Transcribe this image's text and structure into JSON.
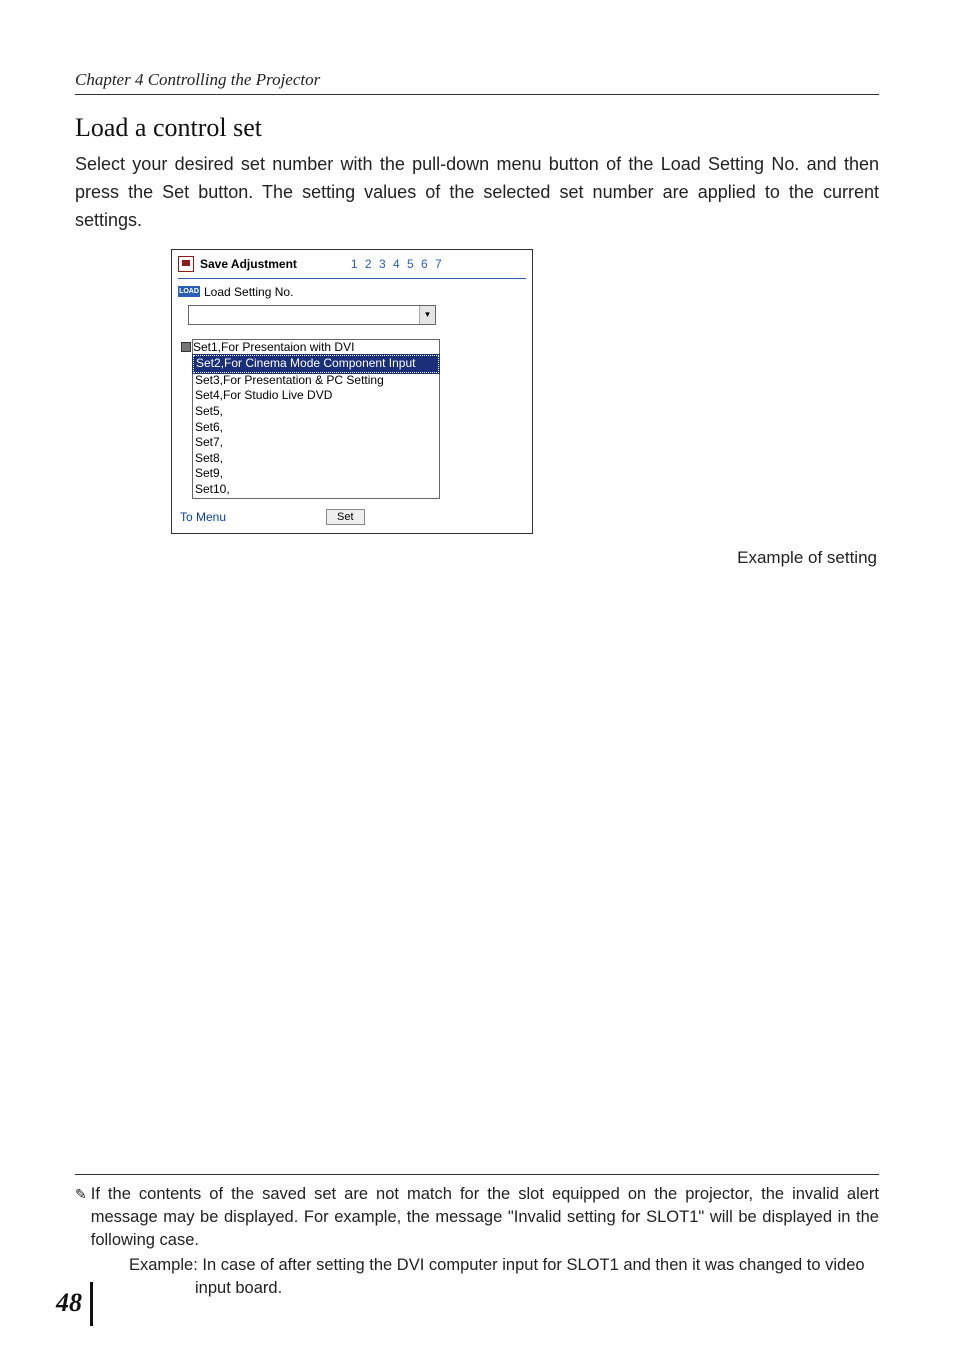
{
  "header": {
    "chapter": "Chapter 4 Controlling the Projector"
  },
  "section": {
    "title": "Load a control set",
    "body": "Select your desired set number with the pull-down menu button of the Load Setting No. and then press the Set button. The setting values of the selected set number are applied to the current settings."
  },
  "screenshot": {
    "saveLabel": "Save Adjustment",
    "pageNumbers": "1 2 3 4 5 6 7",
    "loadIconText": "LOAD",
    "loadLabel": "Load Setting No.",
    "dropdownValue": "",
    "options": [
      "Set1,For Presentaion with DVI",
      "Set2,For Cinema Mode Component Input",
      "Set3,For Presentation & PC Setting",
      "Set4,For Studio Live DVD",
      "Set5,",
      "Set6,",
      "Set7,",
      "Set8,",
      "Set9,",
      "Set10,"
    ],
    "selectedIndex": 1,
    "toMenu": "To Menu",
    "setBtn": "Set"
  },
  "caption": "Example of setting",
  "footnote": {
    "body": "If the contents of the saved set are not match for the slot equipped on the projector, the invalid alert message may be displayed. For example, the message \"Invalid setting for SLOT1\" will be displayed in the following case.",
    "example": "Example: In case of after setting the DVI computer input for SLOT1 and then it was changed to video input board."
  },
  "pageNumber": "48"
}
